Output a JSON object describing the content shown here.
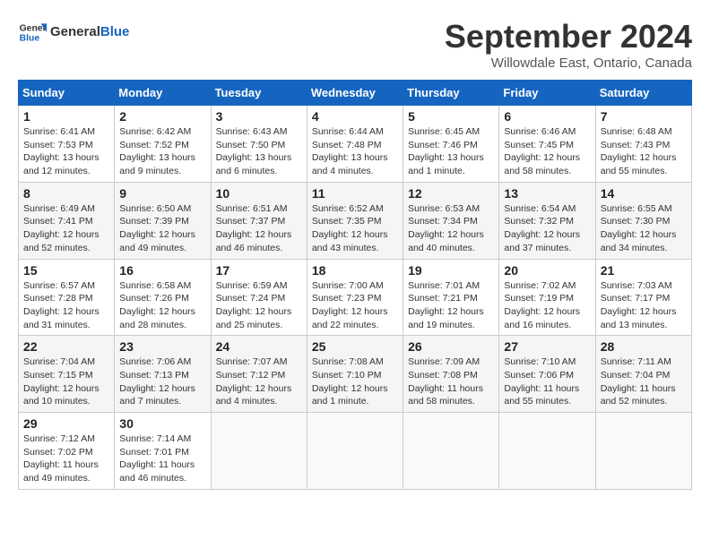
{
  "header": {
    "logo_line1": "General",
    "logo_line2": "Blue",
    "title": "September 2024",
    "location": "Willowdale East, Ontario, Canada"
  },
  "days_of_week": [
    "Sunday",
    "Monday",
    "Tuesday",
    "Wednesday",
    "Thursday",
    "Friday",
    "Saturday"
  ],
  "weeks": [
    [
      {
        "num": "1",
        "sunrise": "6:41 AM",
        "sunset": "7:53 PM",
        "daylight": "13 hours and 12 minutes."
      },
      {
        "num": "2",
        "sunrise": "6:42 AM",
        "sunset": "7:52 PM",
        "daylight": "13 hours and 9 minutes."
      },
      {
        "num": "3",
        "sunrise": "6:43 AM",
        "sunset": "7:50 PM",
        "daylight": "13 hours and 6 minutes."
      },
      {
        "num": "4",
        "sunrise": "6:44 AM",
        "sunset": "7:48 PM",
        "daylight": "13 hours and 4 minutes."
      },
      {
        "num": "5",
        "sunrise": "6:45 AM",
        "sunset": "7:46 PM",
        "daylight": "13 hours and 1 minute."
      },
      {
        "num": "6",
        "sunrise": "6:46 AM",
        "sunset": "7:45 PM",
        "daylight": "12 hours and 58 minutes."
      },
      {
        "num": "7",
        "sunrise": "6:48 AM",
        "sunset": "7:43 PM",
        "daylight": "12 hours and 55 minutes."
      }
    ],
    [
      {
        "num": "8",
        "sunrise": "6:49 AM",
        "sunset": "7:41 PM",
        "daylight": "12 hours and 52 minutes."
      },
      {
        "num": "9",
        "sunrise": "6:50 AM",
        "sunset": "7:39 PM",
        "daylight": "12 hours and 49 minutes."
      },
      {
        "num": "10",
        "sunrise": "6:51 AM",
        "sunset": "7:37 PM",
        "daylight": "12 hours and 46 minutes."
      },
      {
        "num": "11",
        "sunrise": "6:52 AM",
        "sunset": "7:35 PM",
        "daylight": "12 hours and 43 minutes."
      },
      {
        "num": "12",
        "sunrise": "6:53 AM",
        "sunset": "7:34 PM",
        "daylight": "12 hours and 40 minutes."
      },
      {
        "num": "13",
        "sunrise": "6:54 AM",
        "sunset": "7:32 PM",
        "daylight": "12 hours and 37 minutes."
      },
      {
        "num": "14",
        "sunrise": "6:55 AM",
        "sunset": "7:30 PM",
        "daylight": "12 hours and 34 minutes."
      }
    ],
    [
      {
        "num": "15",
        "sunrise": "6:57 AM",
        "sunset": "7:28 PM",
        "daylight": "12 hours and 31 minutes."
      },
      {
        "num": "16",
        "sunrise": "6:58 AM",
        "sunset": "7:26 PM",
        "daylight": "12 hours and 28 minutes."
      },
      {
        "num": "17",
        "sunrise": "6:59 AM",
        "sunset": "7:24 PM",
        "daylight": "12 hours and 25 minutes."
      },
      {
        "num": "18",
        "sunrise": "7:00 AM",
        "sunset": "7:23 PM",
        "daylight": "12 hours and 22 minutes."
      },
      {
        "num": "19",
        "sunrise": "7:01 AM",
        "sunset": "7:21 PM",
        "daylight": "12 hours and 19 minutes."
      },
      {
        "num": "20",
        "sunrise": "7:02 AM",
        "sunset": "7:19 PM",
        "daylight": "12 hours and 16 minutes."
      },
      {
        "num": "21",
        "sunrise": "7:03 AM",
        "sunset": "7:17 PM",
        "daylight": "12 hours and 13 minutes."
      }
    ],
    [
      {
        "num": "22",
        "sunrise": "7:04 AM",
        "sunset": "7:15 PM",
        "daylight": "12 hours and 10 minutes."
      },
      {
        "num": "23",
        "sunrise": "7:06 AM",
        "sunset": "7:13 PM",
        "daylight": "12 hours and 7 minutes."
      },
      {
        "num": "24",
        "sunrise": "7:07 AM",
        "sunset": "7:12 PM",
        "daylight": "12 hours and 4 minutes."
      },
      {
        "num": "25",
        "sunrise": "7:08 AM",
        "sunset": "7:10 PM",
        "daylight": "12 hours and 1 minute."
      },
      {
        "num": "26",
        "sunrise": "7:09 AM",
        "sunset": "7:08 PM",
        "daylight": "11 hours and 58 minutes."
      },
      {
        "num": "27",
        "sunrise": "7:10 AM",
        "sunset": "7:06 PM",
        "daylight": "11 hours and 55 minutes."
      },
      {
        "num": "28",
        "sunrise": "7:11 AM",
        "sunset": "7:04 PM",
        "daylight": "11 hours and 52 minutes."
      }
    ],
    [
      {
        "num": "29",
        "sunrise": "7:12 AM",
        "sunset": "7:02 PM",
        "daylight": "11 hours and 49 minutes."
      },
      {
        "num": "30",
        "sunrise": "7:14 AM",
        "sunset": "7:01 PM",
        "daylight": "11 hours and 46 minutes."
      },
      null,
      null,
      null,
      null,
      null
    ]
  ]
}
